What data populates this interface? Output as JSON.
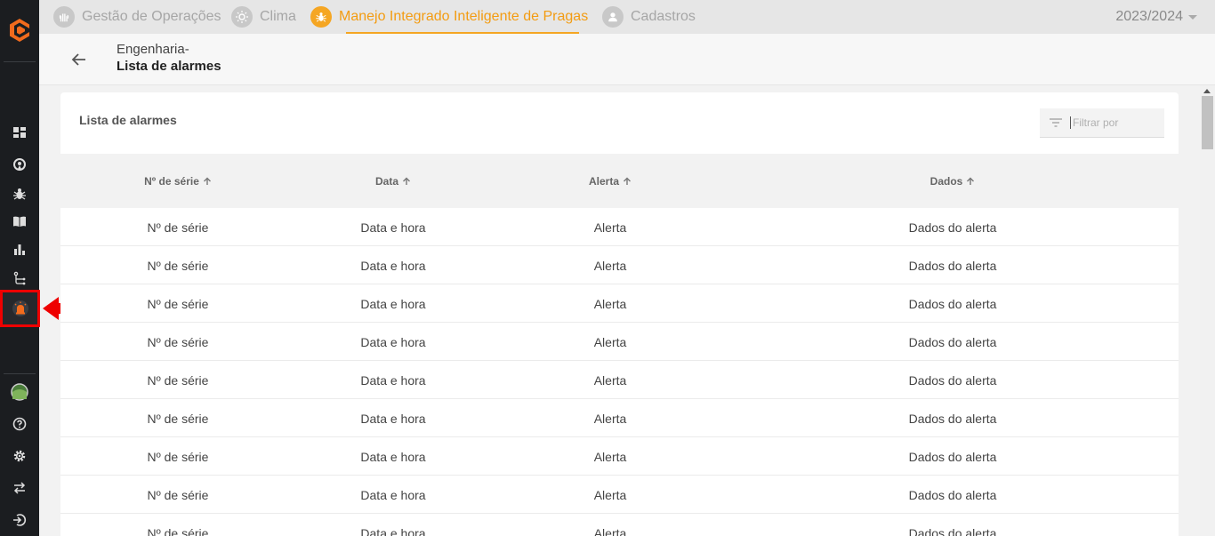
{
  "topbar": {
    "tabs": [
      {
        "label": "Gestão de Operações",
        "icon": "operations-icon",
        "active": false
      },
      {
        "label": "Clima",
        "icon": "sun-icon",
        "active": false
      },
      {
        "label": "Manejo Integrado Inteligente de Pragas",
        "icon": "bug-icon",
        "active": true
      },
      {
        "label": "Cadastros",
        "icon": "user-icon",
        "active": false
      }
    ],
    "season": "2023/2024"
  },
  "header": {
    "breadcrumb_parent": "Engenharia-",
    "title": "Lista de alarmes"
  },
  "card": {
    "title": "Lista de alarmes",
    "filter_placeholder": "Filtrar por"
  },
  "table": {
    "columns": [
      "Nº de série",
      "Data",
      "Alerta",
      "Dados"
    ],
    "rows": [
      [
        "Nº de série",
        "Data e hora",
        "Alerta",
        "Dados do alerta"
      ],
      [
        "Nº de série",
        "Data e hora",
        "Alerta",
        "Dados do alerta"
      ],
      [
        "Nº de série",
        "Data e hora",
        "Alerta",
        "Dados do alerta"
      ],
      [
        "Nº de série",
        "Data e hora",
        "Alerta",
        "Dados do alerta"
      ],
      [
        "Nº de série",
        "Data e hora",
        "Alerta",
        "Dados do alerta"
      ],
      [
        "Nº de série",
        "Data e hora",
        "Alerta",
        "Dados do alerta"
      ],
      [
        "Nº de série",
        "Data e hora",
        "Alerta",
        "Dados do alerta"
      ],
      [
        "Nº de série",
        "Data e hora",
        "Alerta",
        "Dados do alerta"
      ],
      [
        "Nº de série",
        "Data e hora",
        "Alerta",
        "Dados do alerta"
      ]
    ]
  },
  "sidebar": {
    "items": [
      "dashboard-icon",
      "location-icon",
      "bug-icon",
      "book-icon",
      "bar-chart-icon",
      "route-icon",
      "alarm-icon"
    ],
    "bottom_items": [
      "avatar",
      "help-icon",
      "settings-icon",
      "switch-icon",
      "logout-icon"
    ]
  },
  "colors": {
    "accent": "#f5a623",
    "sidebar_bg": "#1b1d20",
    "highlight_red": "#ee0000"
  }
}
